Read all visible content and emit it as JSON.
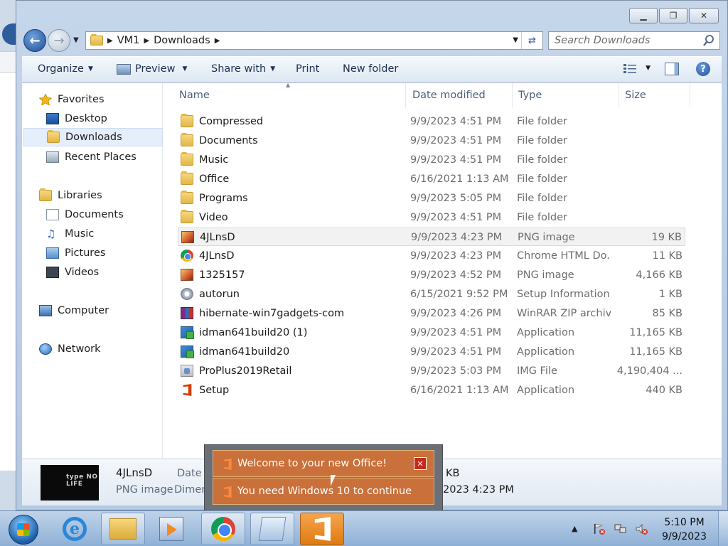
{
  "window": {
    "caption": {
      "minimize": "▁",
      "maximize": "❐",
      "close": "✕"
    },
    "address": {
      "segments": [
        "VM1",
        "Downloads"
      ]
    },
    "search": {
      "placeholder": "Search Downloads"
    }
  },
  "commandbar": {
    "organize": "Organize",
    "preview": "Preview",
    "share_with": "Share with",
    "print": "Print",
    "new_folder": "New folder"
  },
  "navpane": {
    "favorites": {
      "title": "Favorites",
      "items": [
        "Desktop",
        "Downloads",
        "Recent Places"
      ]
    },
    "libraries": {
      "title": "Libraries",
      "items": [
        "Documents",
        "Music",
        "Pictures",
        "Videos"
      ]
    },
    "computer": "Computer",
    "network": "Network"
  },
  "columns": {
    "name": "Name",
    "date": "Date modified",
    "type": "Type",
    "size": "Size"
  },
  "files": [
    {
      "name": "Compressed",
      "date": "9/9/2023 4:51 PM",
      "type": "File folder",
      "size": "",
      "icon": "folder"
    },
    {
      "name": "Documents",
      "date": "9/9/2023 4:51 PM",
      "type": "File folder",
      "size": "",
      "icon": "folder"
    },
    {
      "name": "Music",
      "date": "9/9/2023 4:51 PM",
      "type": "File folder",
      "size": "",
      "icon": "folder"
    },
    {
      "name": "Office",
      "date": "6/16/2021 1:13 AM",
      "type": "File folder",
      "size": "",
      "icon": "folder"
    },
    {
      "name": "Programs",
      "date": "9/9/2023 5:05 PM",
      "type": "File folder",
      "size": "",
      "icon": "folder"
    },
    {
      "name": "Video",
      "date": "9/9/2023 4:51 PM",
      "type": "File folder",
      "size": "",
      "icon": "folder"
    },
    {
      "name": "4JLnsD",
      "date": "9/9/2023 4:23 PM",
      "type": "PNG image",
      "size": "19 KB",
      "icon": "png"
    },
    {
      "name": "4JLnsD",
      "date": "9/9/2023 4:23 PM",
      "type": "Chrome HTML Do...",
      "size": "11 KB",
      "icon": "chrome"
    },
    {
      "name": "1325157",
      "date": "9/9/2023 4:52 PM",
      "type": "PNG image",
      "size": "4,166 KB",
      "icon": "png"
    },
    {
      "name": "autorun",
      "date": "6/15/2021 9:52 PM",
      "type": "Setup Information",
      "size": "1 KB",
      "icon": "setupinfo"
    },
    {
      "name": "hibernate-win7gadgets-com",
      "date": "9/9/2023 4:26 PM",
      "type": "WinRAR ZIP archive",
      "size": "85 KB",
      "icon": "winrar"
    },
    {
      "name": "idman641build20 (1)",
      "date": "9/9/2023 4:51 PM",
      "type": "Application",
      "size": "11,165 KB",
      "icon": "idman"
    },
    {
      "name": "idman641build20",
      "date": "9/9/2023 4:51 PM",
      "type": "Application",
      "size": "11,165 KB",
      "icon": "idman"
    },
    {
      "name": "ProPlus2019Retail",
      "date": "9/9/2023 5:03 PM",
      "type": "IMG File",
      "size": "4,190,404 ...",
      "icon": "img"
    },
    {
      "name": "Setup",
      "date": "6/16/2021 1:13 AM",
      "type": "Application",
      "size": "440 KB",
      "icon": "office"
    }
  ],
  "details": {
    "thumb_text": "type NO LIFE",
    "name": "4JLnsD",
    "type": "PNG image",
    "label_date": "Date t",
    "label_dims": "Dimen",
    "size_fragment": "KB",
    "date_fragment": "2023 4:23 PM"
  },
  "toast": {
    "line1": "Welcome to your new Office!",
    "line2": "You need Windows 10 to continue",
    "close": "✕"
  },
  "taskbar": {
    "time": "5:10 PM",
    "date": "9/9/2023",
    "ie_glyph": "e"
  }
}
